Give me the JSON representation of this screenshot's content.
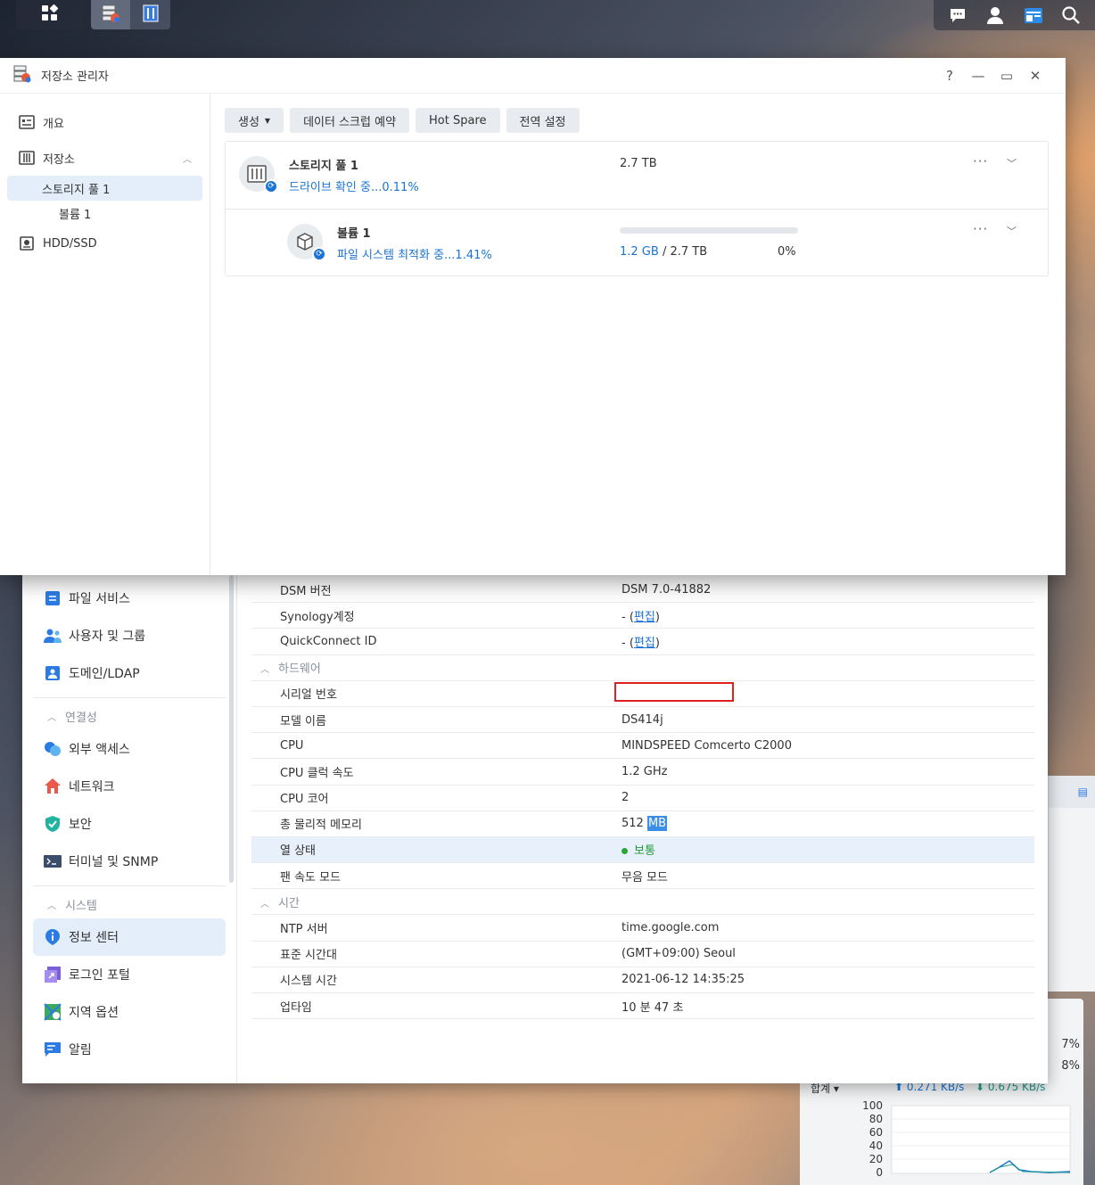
{
  "storage_manager": {
    "title": "저장소 관리자",
    "window_buttons": {
      "help": "?",
      "minimize": "—",
      "maximize": "▭",
      "close": "✕"
    },
    "nav": {
      "overview": "개요",
      "storage": "저장소",
      "pool": "스토리지 풀 1",
      "volume": "볼륨 1",
      "hdd": "HDD/SSD"
    },
    "toolbar": {
      "create": "생성",
      "scrub": "데이터 스크럽 예약",
      "hot_spare": "Hot Spare",
      "global": "전역 설정"
    },
    "pool": {
      "name": "스토리지 풀 1",
      "status": "드라이브 확인 중...0.11%",
      "size": "2.7 TB"
    },
    "volume": {
      "name": "볼륨 1",
      "status": "파일 시스템 최적화 중...1.41%",
      "used": "1.2 GB",
      "separator": " / ",
      "total": "2.7 TB",
      "percent": "0%",
      "usage_fraction": 0.0
    }
  },
  "control_panel": {
    "sidebar": {
      "file_services": "파일 서비스",
      "users_groups": "사용자 및 그룹",
      "domain_ldap": "도메인/LDAP",
      "section_connectivity": "연결성",
      "external_access": "외부 액세스",
      "network": "네트워크",
      "security": "보안",
      "terminal_snmp": "터미널 및 SNMP",
      "section_system": "시스템",
      "info_center": "정보 센터",
      "login_portal": "로그인 포털",
      "regional_options": "지역 옵션",
      "notifications": "알림"
    },
    "info": {
      "dsm_version_label": "DSM 버전",
      "dsm_version": "DSM 7.0-41882",
      "synology_account_label": "Synology계정",
      "quickconnect_label": "QuickConnect ID",
      "value_prefix": "- (",
      "edit_link": "편집",
      "value_suffix": ")",
      "hardware_section": "하드웨어",
      "serial_label": "시리얼 번호",
      "model_label": "모델 이름",
      "model": "DS414j",
      "cpu_label": "CPU",
      "cpu": "MINDSPEED Comcerto C2000",
      "cpu_clock_label": "CPU 클럭 속도",
      "cpu_clock": "1.2 GHz",
      "cpu_cores_label": "CPU 코어",
      "cpu_cores": "2",
      "memory_label": "총 물리적 메모리",
      "memory_num": "512 ",
      "memory_unit": "MB",
      "thermal_label": "열 상태",
      "thermal": "보통",
      "fan_label": "팬 속도 모드",
      "fan": "무음 모드",
      "time_section": "시간",
      "ntp_label": "NTP 서버",
      "ntp": "time.google.com",
      "timezone_label": "표준 시간대",
      "timezone": "(GMT+09:00) Seoul",
      "system_time_label": "시스템 시간",
      "system_time": "2021-06-12 14:35:25",
      "uptime_label": "업타임",
      "uptime": "10 분 47 초"
    }
  },
  "resource_widget": {
    "pct1": "7%",
    "pct2": "8%",
    "total_label": "합계 ▾",
    "upload": "⬆ 0.271 KB/s",
    "download": "⬇ 0.675 KB/s",
    "y_ticks": [
      "100",
      "80",
      "60",
      "40",
      "20",
      "0"
    ]
  },
  "colors": {
    "accent": "#1a73d5",
    "selected_bg": "#e3eefa",
    "status_green": "#29a635",
    "redact_box": "#e02020"
  }
}
